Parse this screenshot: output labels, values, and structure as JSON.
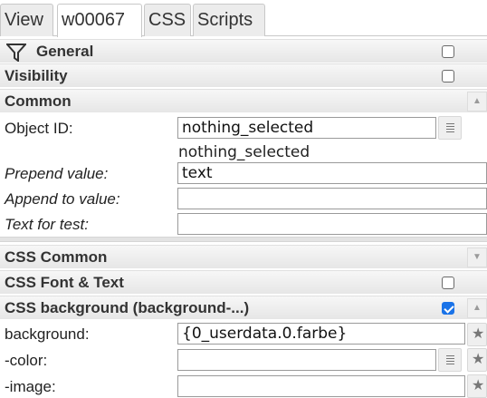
{
  "tabs": [
    {
      "label": "View"
    },
    {
      "label": "w00067"
    },
    {
      "label": "CSS"
    },
    {
      "label": "Scripts"
    }
  ],
  "sections": {
    "general": {
      "label": "General",
      "checked": false
    },
    "visibility": {
      "label": "Visibility",
      "checked": false
    },
    "common": {
      "label": "Common"
    },
    "css_common": {
      "label": "CSS Common"
    },
    "css_font_text": {
      "label": "CSS Font & Text",
      "checked": false
    },
    "css_background": {
      "label": "CSS background (background-...)",
      "checked": true
    }
  },
  "common_fields": {
    "object_id": {
      "label": "Object ID:",
      "value": "nothing_selected",
      "hint": "nothing_selected"
    },
    "prepend": {
      "label": "Prepend value:",
      "value": "text"
    },
    "append": {
      "label": "Append to value:",
      "value": ""
    },
    "test_text": {
      "label": "Text for test:",
      "value": ""
    }
  },
  "background_fields": {
    "background": {
      "label": "background:",
      "value": "{0_userdata.0.farbe}"
    },
    "color": {
      "label": "-color:",
      "value": ""
    },
    "image": {
      "label": "-image:",
      "value": ""
    }
  },
  "icons": {
    "filter": "funnel-icon",
    "browse": "list-icon",
    "star": "star-icon",
    "collapse": "triangle-up-icon",
    "expand": "triangle-down-icon"
  }
}
